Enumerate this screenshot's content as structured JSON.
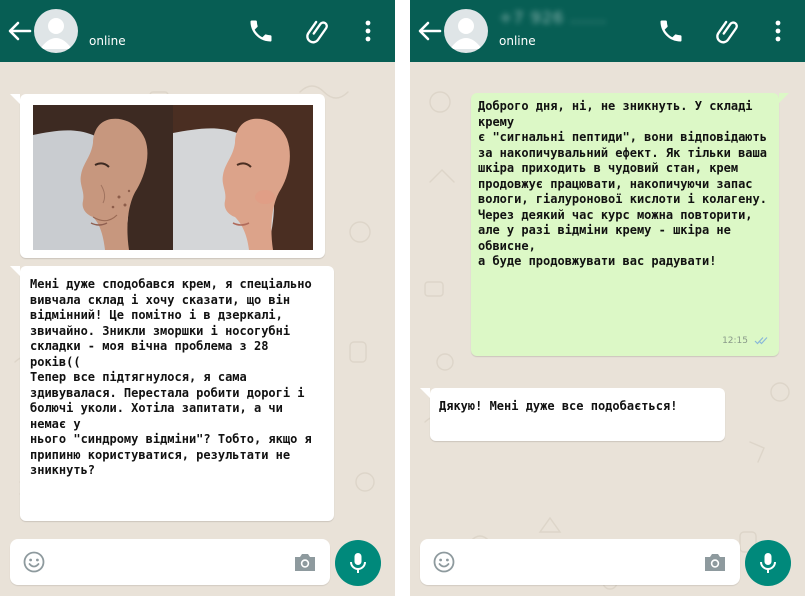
{
  "colors": {
    "header": "#075e54",
    "chat_background": "#e9e2d8",
    "incoming_bubble": "#ffffff",
    "outgoing_bubble": "#dcf8c6",
    "mic_button": "#00897b"
  },
  "left_chat": {
    "header": {
      "status": "online",
      "icons": [
        "back-arrow-icon",
        "avatar",
        "phone-icon",
        "paperclip-icon",
        "more-vert-icon"
      ]
    },
    "messages": [
      {
        "direction": "incoming",
        "kind": "photos",
        "images": [
          "face-before-photo",
          "face-after-photo"
        ]
      },
      {
        "direction": "incoming",
        "kind": "text",
        "lines": [
          "Мені дуже сподобався крем, я спеціально",
          "вивчала склад і хочу сказати, що він",
          "відмінний! Це помітно і в дзеркалі,",
          "звичайно. Зникли зморшки і носогубні",
          "складки - моя вічна проблема з 28 років((",
          "Тепер все підтягнулося, я сама",
          "здивувалася. Перестала робити дорогі і",
          "болючі уколи. Хотіла запитати, а чи немає у",
          "нього \"синдрому відміни\"? Тобто, якщо я",
          "припиню користуватися, результати не",
          "зникнуть?"
        ]
      }
    ],
    "composer": {
      "icons": [
        "emoji-icon",
        "camera-icon",
        "mic-icon"
      ]
    }
  },
  "right_chat": {
    "header": {
      "contact_name": "+7 926 ......",
      "status": "online",
      "icons": [
        "back-arrow-icon",
        "avatar",
        "phone-icon",
        "paperclip-icon",
        "more-vert-icon"
      ]
    },
    "messages": [
      {
        "direction": "outgoing",
        "kind": "text",
        "lines": [
          "Доброго дня, ні, не зникнуть. У складі крему",
          "є \"сигнальні пептиди\", вони відповідають",
          "за накопичувальний ефект. Як тільки ваша",
          "шкіра приходить в чудовий стан, крем",
          "продовжує працювати, накопичуючи запас",
          "вологи, гіалуронової кислоти і колагену.",
          "Через деякий час курс можна повторити,",
          "але у разі відміни крему - шкіра не обвисне,",
          "а буде продовжувати вас радувати!"
        ],
        "time": "12:15",
        "status": "read-ticks-icon"
      },
      {
        "direction": "incoming",
        "kind": "text",
        "lines": [
          "Дякую! Мені дуже все подобається!"
        ]
      }
    ],
    "composer": {
      "icons": [
        "emoji-icon",
        "camera-icon",
        "mic-icon"
      ]
    }
  }
}
